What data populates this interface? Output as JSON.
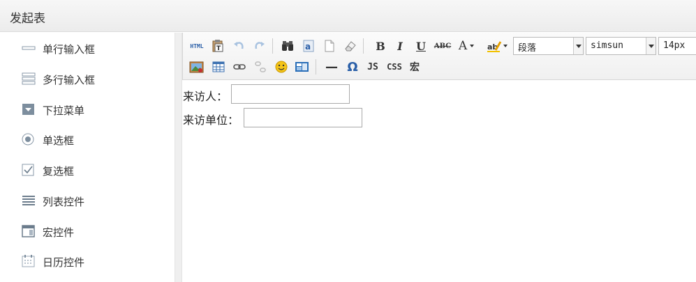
{
  "header": {
    "title": "发起表"
  },
  "sidebar": {
    "items": [
      {
        "label": "单行输入框",
        "icon": "single-line-input-icon"
      },
      {
        "label": "多行输入框",
        "icon": "multi-line-input-icon"
      },
      {
        "label": "下拉菜单",
        "icon": "dropdown-icon"
      },
      {
        "label": "单选框",
        "icon": "radio-icon"
      },
      {
        "label": "复选框",
        "icon": "checkbox-icon"
      },
      {
        "label": "列表控件",
        "icon": "list-icon"
      },
      {
        "label": "宏控件",
        "icon": "macro-icon"
      },
      {
        "label": "日历控件",
        "icon": "calendar-icon"
      }
    ]
  },
  "toolbar": {
    "html_label": "HTML",
    "bold_label": "B",
    "italic_label": "I",
    "underline_label": "U",
    "strike_label": "ABC",
    "fontcolor_label": "A",
    "paragraph_select": "段落",
    "font_select": "simsun",
    "size_select": "14px",
    "js_label": "JS",
    "css_label": "CSS",
    "macro_label": "宏",
    "special_char_label": "Ω",
    "hr_label": "—"
  },
  "form": {
    "fields": [
      {
        "label": "来访人：",
        "value": ""
      },
      {
        "label": "来访单位：",
        "value": ""
      }
    ]
  }
}
